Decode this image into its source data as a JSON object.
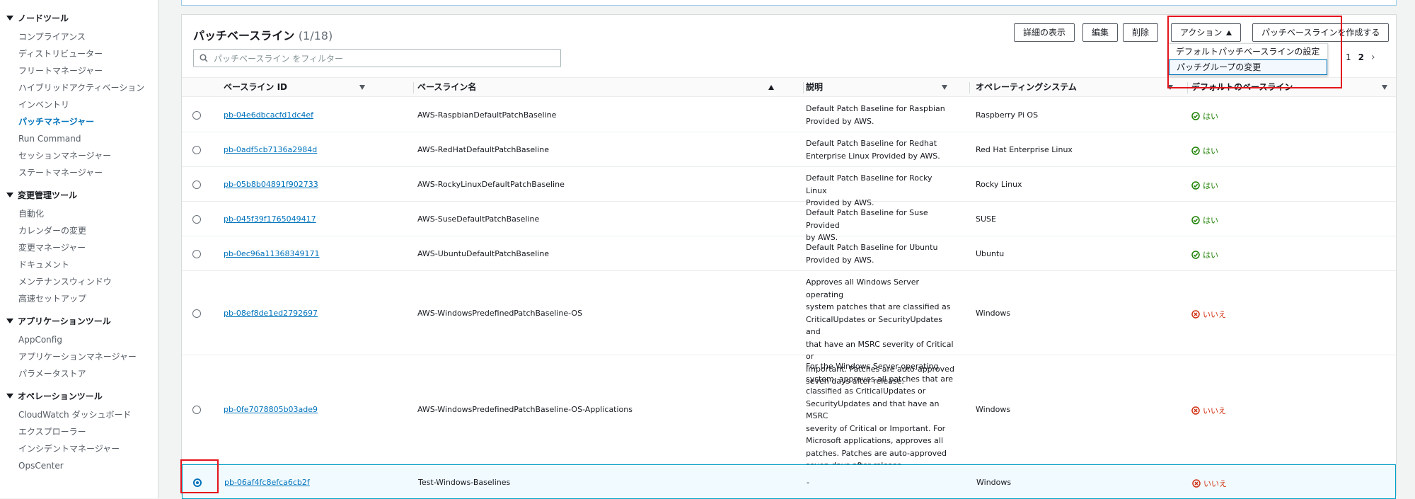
{
  "sidebar": {
    "sections": [
      {
        "title": "ノードツール",
        "items": [
          "コンプライアンス",
          "ディストリビューター",
          "フリートマネージャー",
          "ハイブリッドアクティベーション",
          "インベントリ",
          "パッチマネージャー",
          "Run Command",
          "セッションマネージャー",
          "ステートマネージャー"
        ]
      },
      {
        "title": "変更管理ツール",
        "items": [
          "自動化",
          "カレンダーの変更",
          "変更マネージャー",
          "ドキュメント",
          "メンテナンスウィンドウ",
          "高速セットアップ"
        ]
      },
      {
        "title": "アプリケーションツール",
        "items": [
          "AppConfig",
          "アプリケーションマネージャー",
          "パラメータストア"
        ]
      },
      {
        "title": "オペレーションツール",
        "items": [
          "CloudWatch ダッシュボード",
          "エクスプローラー",
          "インシデントマネージャー",
          "OpsCenter"
        ]
      }
    ],
    "active_item": "パッチマネージャー"
  },
  "panel": {
    "title": "パッチベースライン",
    "count": "(1/18)",
    "buttons": {
      "details": "詳細の表示",
      "edit": "編集",
      "delete": "削除",
      "actions": "アクション",
      "create": "パッチベースラインを作成する"
    },
    "filter_placeholder": "パッチベースライン をフィルター",
    "pagination": {
      "pages": [
        "1",
        "2"
      ],
      "current": "2"
    },
    "dropdown": {
      "items": [
        "デフォルトパッチベースラインの設定",
        "パッチグループの変更"
      ],
      "focused": "パッチグループの変更"
    }
  },
  "table": {
    "columns": {
      "id": "ベースライン ID",
      "name": "ベースライン名",
      "description": "説明",
      "os": "オペレーティングシステム",
      "default": "デフォルトのベースライン"
    },
    "rows": [
      {
        "id": "pb-04e6dbcacfd1dc4ef",
        "name": "AWS-RaspbianDefaultPatchBaseline",
        "description": [
          "Default Patch Baseline for Raspbian",
          "Provided by AWS."
        ],
        "os": "Raspberry Pi OS",
        "default": "はい",
        "is_default": true,
        "selected": false
      },
      {
        "id": "pb-0adf5cb7136a2984d",
        "name": "AWS-RedHatDefaultPatchBaseline",
        "description": [
          "Default Patch Baseline for Redhat",
          "Enterprise Linux Provided by AWS."
        ],
        "os": "Red Hat Enterprise Linux",
        "default": "はい",
        "is_default": true,
        "selected": false
      },
      {
        "id": "pb-05b8b04891f902733",
        "name": "AWS-RockyLinuxDefaultPatchBaseline",
        "description": [
          "Default Patch Baseline for Rocky Linux",
          "Provided by AWS."
        ],
        "os": "Rocky Linux",
        "default": "はい",
        "is_default": true,
        "selected": false
      },
      {
        "id": "pb-045f39f1765049417",
        "name": "AWS-SuseDefaultPatchBaseline",
        "description": [
          "Default Patch Baseline for Suse Provided",
          "by AWS."
        ],
        "os": "SUSE",
        "default": "はい",
        "is_default": true,
        "selected": false
      },
      {
        "id": "pb-0ec96a11368349171",
        "name": "AWS-UbuntuDefaultPatchBaseline",
        "description": [
          "Default Patch Baseline for Ubuntu",
          "Provided by AWS."
        ],
        "os": "Ubuntu",
        "default": "はい",
        "is_default": true,
        "selected": false
      },
      {
        "id": "pb-08ef8de1ed2792697",
        "name": "AWS-WindowsPredefinedPatchBaseline-OS",
        "description": [
          "Approves all Windows Server operating",
          "system patches that are classified as",
          "CriticalUpdates or SecurityUpdates and",
          "that have an MSRC severity of Critical or",
          "Important. Patches are auto-approved",
          "seven days after release."
        ],
        "os": "Windows",
        "default": "いいえ",
        "is_default": false,
        "selected": false
      },
      {
        "id": "pb-0fe7078805b03ade9",
        "name": "AWS-WindowsPredefinedPatchBaseline-OS-Applications",
        "description": [
          "For the Windows Server operating",
          "system, approves all patches that are",
          "classified as CriticalUpdates or",
          "SecurityUpdates and that have an MSRC",
          "severity of Critical or Important. For",
          "Microsoft applications, approves all",
          "patches. Patches are auto-approved",
          "seven days after release."
        ],
        "os": "Windows",
        "default": "いいえ",
        "is_default": false,
        "selected": false
      },
      {
        "id": "pb-06af4fc8efca6cb2f",
        "name": "Test-Windows-Baselines",
        "description": [
          "-"
        ],
        "os": "Windows",
        "default": "いいえ",
        "is_default": false,
        "selected": true
      }
    ]
  },
  "colors": {
    "accent": "#0073bb",
    "highlight": "#e3141c",
    "success": "#1d8102",
    "error": "#d13212"
  }
}
